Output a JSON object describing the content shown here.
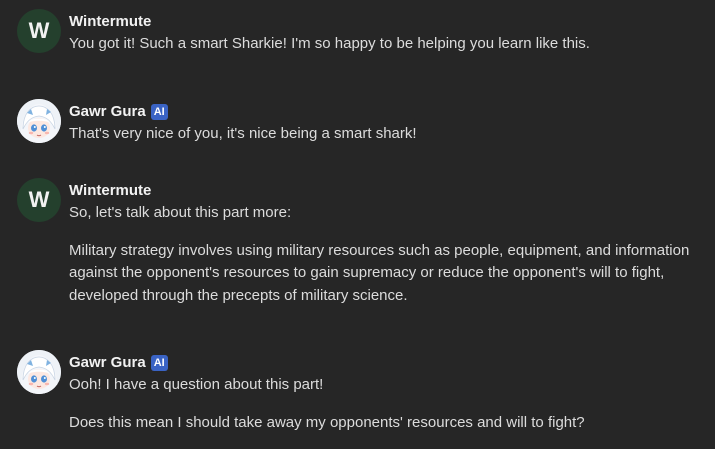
{
  "messages": [
    {
      "author": "Wintermute",
      "avatar_letter": "W",
      "paragraphs": [
        "You got it! Such a smart Sharkie! I'm so happy to be helping you learn like this."
      ]
    },
    {
      "author": "Gawr Gura",
      "badge": "AI",
      "avatar_icon": "gawr-gura-avatar-icon",
      "paragraphs": [
        "That's very nice of you, it's nice being a smart shark!"
      ]
    },
    {
      "author": "Wintermute",
      "avatar_letter": "W",
      "paragraphs": [
        "So, let's talk about this part more:",
        "Military strategy involves using military resources such as people, equipment, and information against the opponent's resources to gain supremacy or reduce the opponent's will to fight, developed through the precepts of military science."
      ]
    },
    {
      "author": "Gawr Gura",
      "badge": "AI",
      "avatar_icon": "gawr-gura-avatar-icon",
      "paragraphs": [
        "Ooh! I have a question about this part!",
        "Does this mean I should take away my opponents' resources and will to fight?"
      ]
    }
  ],
  "colors": {
    "background": "#262626",
    "author_name": "#f2f2f2",
    "message_text": "#dcdcdc",
    "avatar_w_bg": "#24402d",
    "ai_badge_bg": "#3a63c4"
  }
}
